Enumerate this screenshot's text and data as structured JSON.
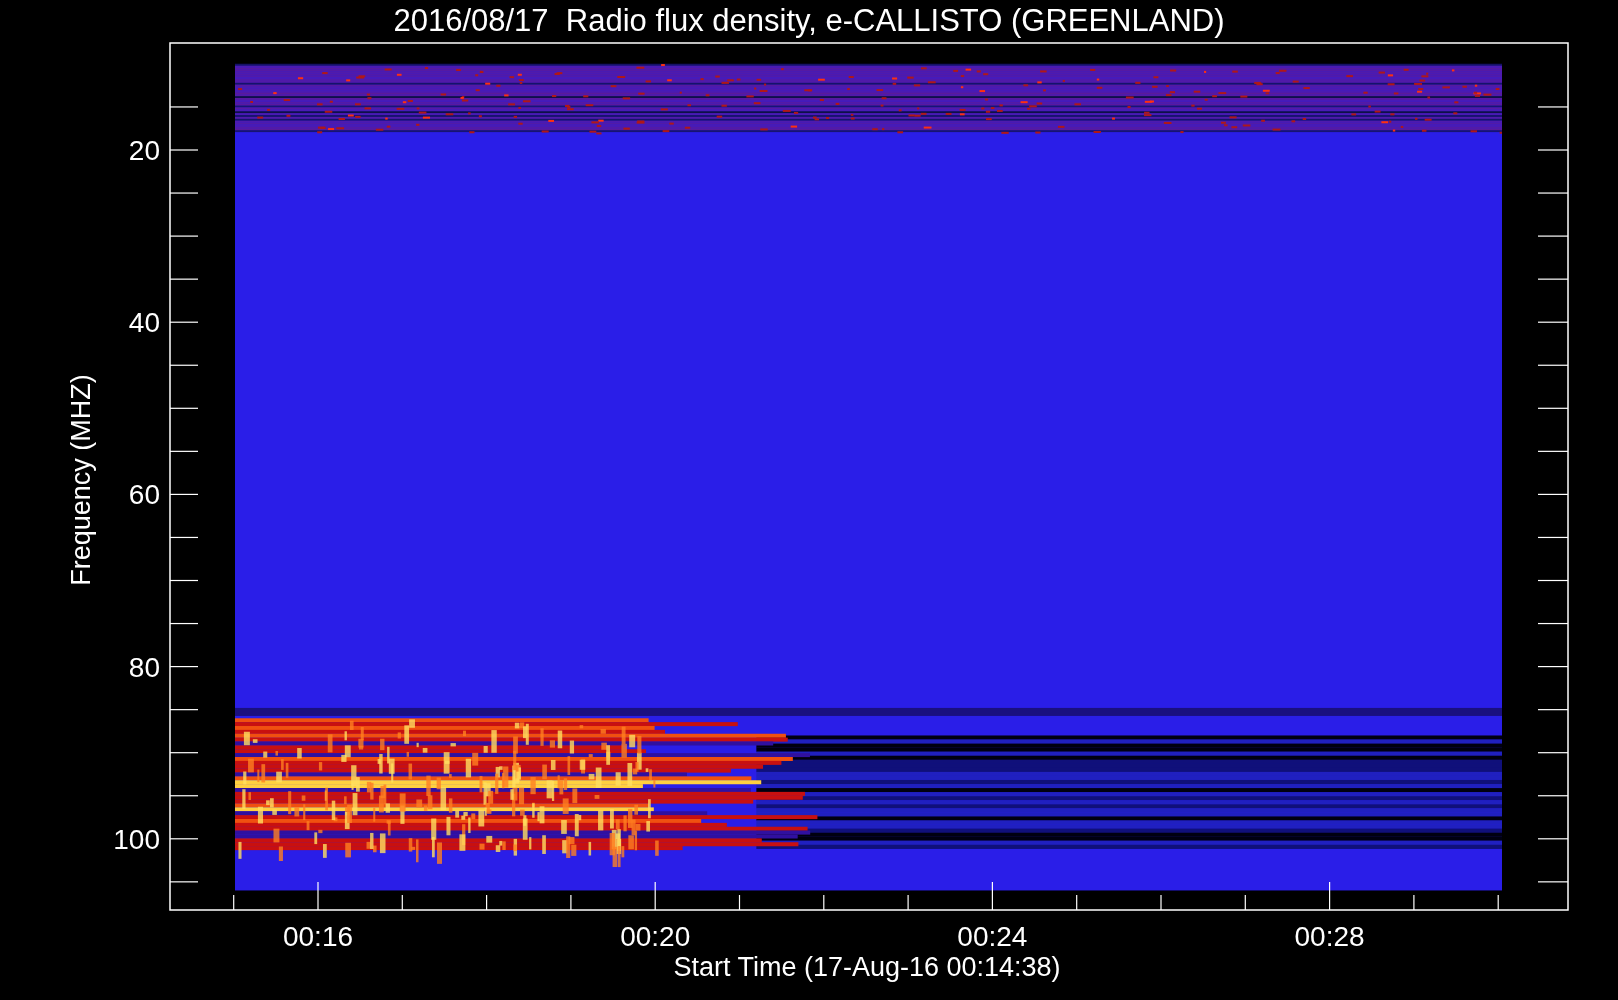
{
  "title": "2016/08/17  Radio flux density, e-CALLISTO (GREENLAND)",
  "y_axis": {
    "label": "Frequency (MHZ)",
    "ticks": [
      "20",
      "40",
      "60",
      "80",
      "100"
    ]
  },
  "x_axis": {
    "label": "Start Time (17-Aug-16 00:14:38)",
    "ticks": [
      "00:16",
      "00:20",
      "00:24",
      "00:28"
    ]
  }
}
